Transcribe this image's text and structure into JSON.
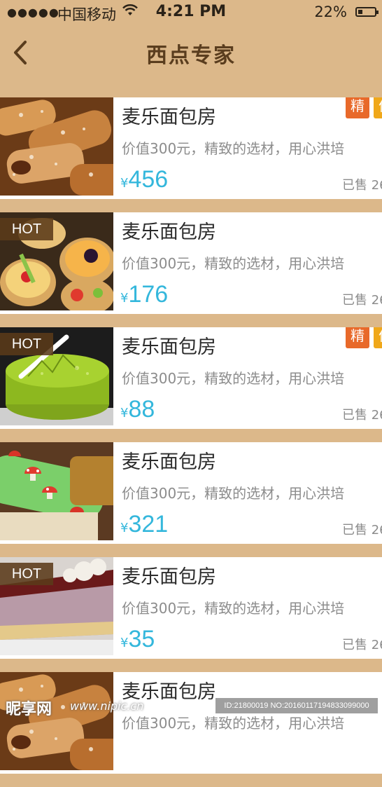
{
  "status_bar": {
    "signal": "●●●●●",
    "carrier": "中国移动",
    "time": "4:21 PM",
    "battery_percent": "22%"
  },
  "navbar": {
    "title": "西点专家",
    "back_icon": "chevron-left-icon"
  },
  "items": [
    {
      "name": "麦乐面包房",
      "desc": "价值300元，精致的选材，用心洪培",
      "currency": "¥",
      "price": "456",
      "sold": "已售 26",
      "hot": "",
      "tags": [
        "精",
        "优"
      ],
      "image": "pastry-rolls"
    },
    {
      "name": "麦乐面包房",
      "desc": "价值300元，精致的选材，用心洪培",
      "currency": "¥",
      "price": "176",
      "sold": "已售 26",
      "hot": "HOT",
      "tags": [],
      "image": "fruit-tarts"
    },
    {
      "name": "麦乐面包房",
      "desc": "价值300元，精致的选材，用心洪培",
      "currency": "¥",
      "price": "88",
      "sold": "已售 26",
      "hot": "HOT",
      "tags": [
        "精",
        "优"
      ],
      "image": "matcha-cake"
    },
    {
      "name": "麦乐面包房",
      "desc": "价值300元，精致的选材，用心洪培",
      "currency": "¥",
      "price": "321",
      "sold": "已售 26",
      "hot": "",
      "tags": [],
      "image": "mushroom-roll-cake"
    },
    {
      "name": "麦乐面包房",
      "desc": "价值300元，精致的选材，用心洪培",
      "currency": "¥",
      "price": "35",
      "sold": "已售 26",
      "hot": "HOT",
      "tags": [],
      "image": "berry-cake-slice"
    },
    {
      "name": "麦乐面包房",
      "desc": "价值300元，精致的选材，用心洪培",
      "currency": "¥",
      "price": "",
      "sold": "",
      "hot": "",
      "tags": [],
      "image": "pastry-rolls"
    }
  ],
  "watermark": {
    "logo": "昵享网",
    "url": "www.nipic.cn",
    "id_text": "ID:21800019 NO:20160117194833099000"
  },
  "colors": {
    "background": "#dcb88a",
    "title": "#5a3d1e",
    "price": "#34b7dc",
    "tag_jing": "#e8692a",
    "tag_you": "#f0a81a",
    "hot_badge": "#5a3a19"
  }
}
